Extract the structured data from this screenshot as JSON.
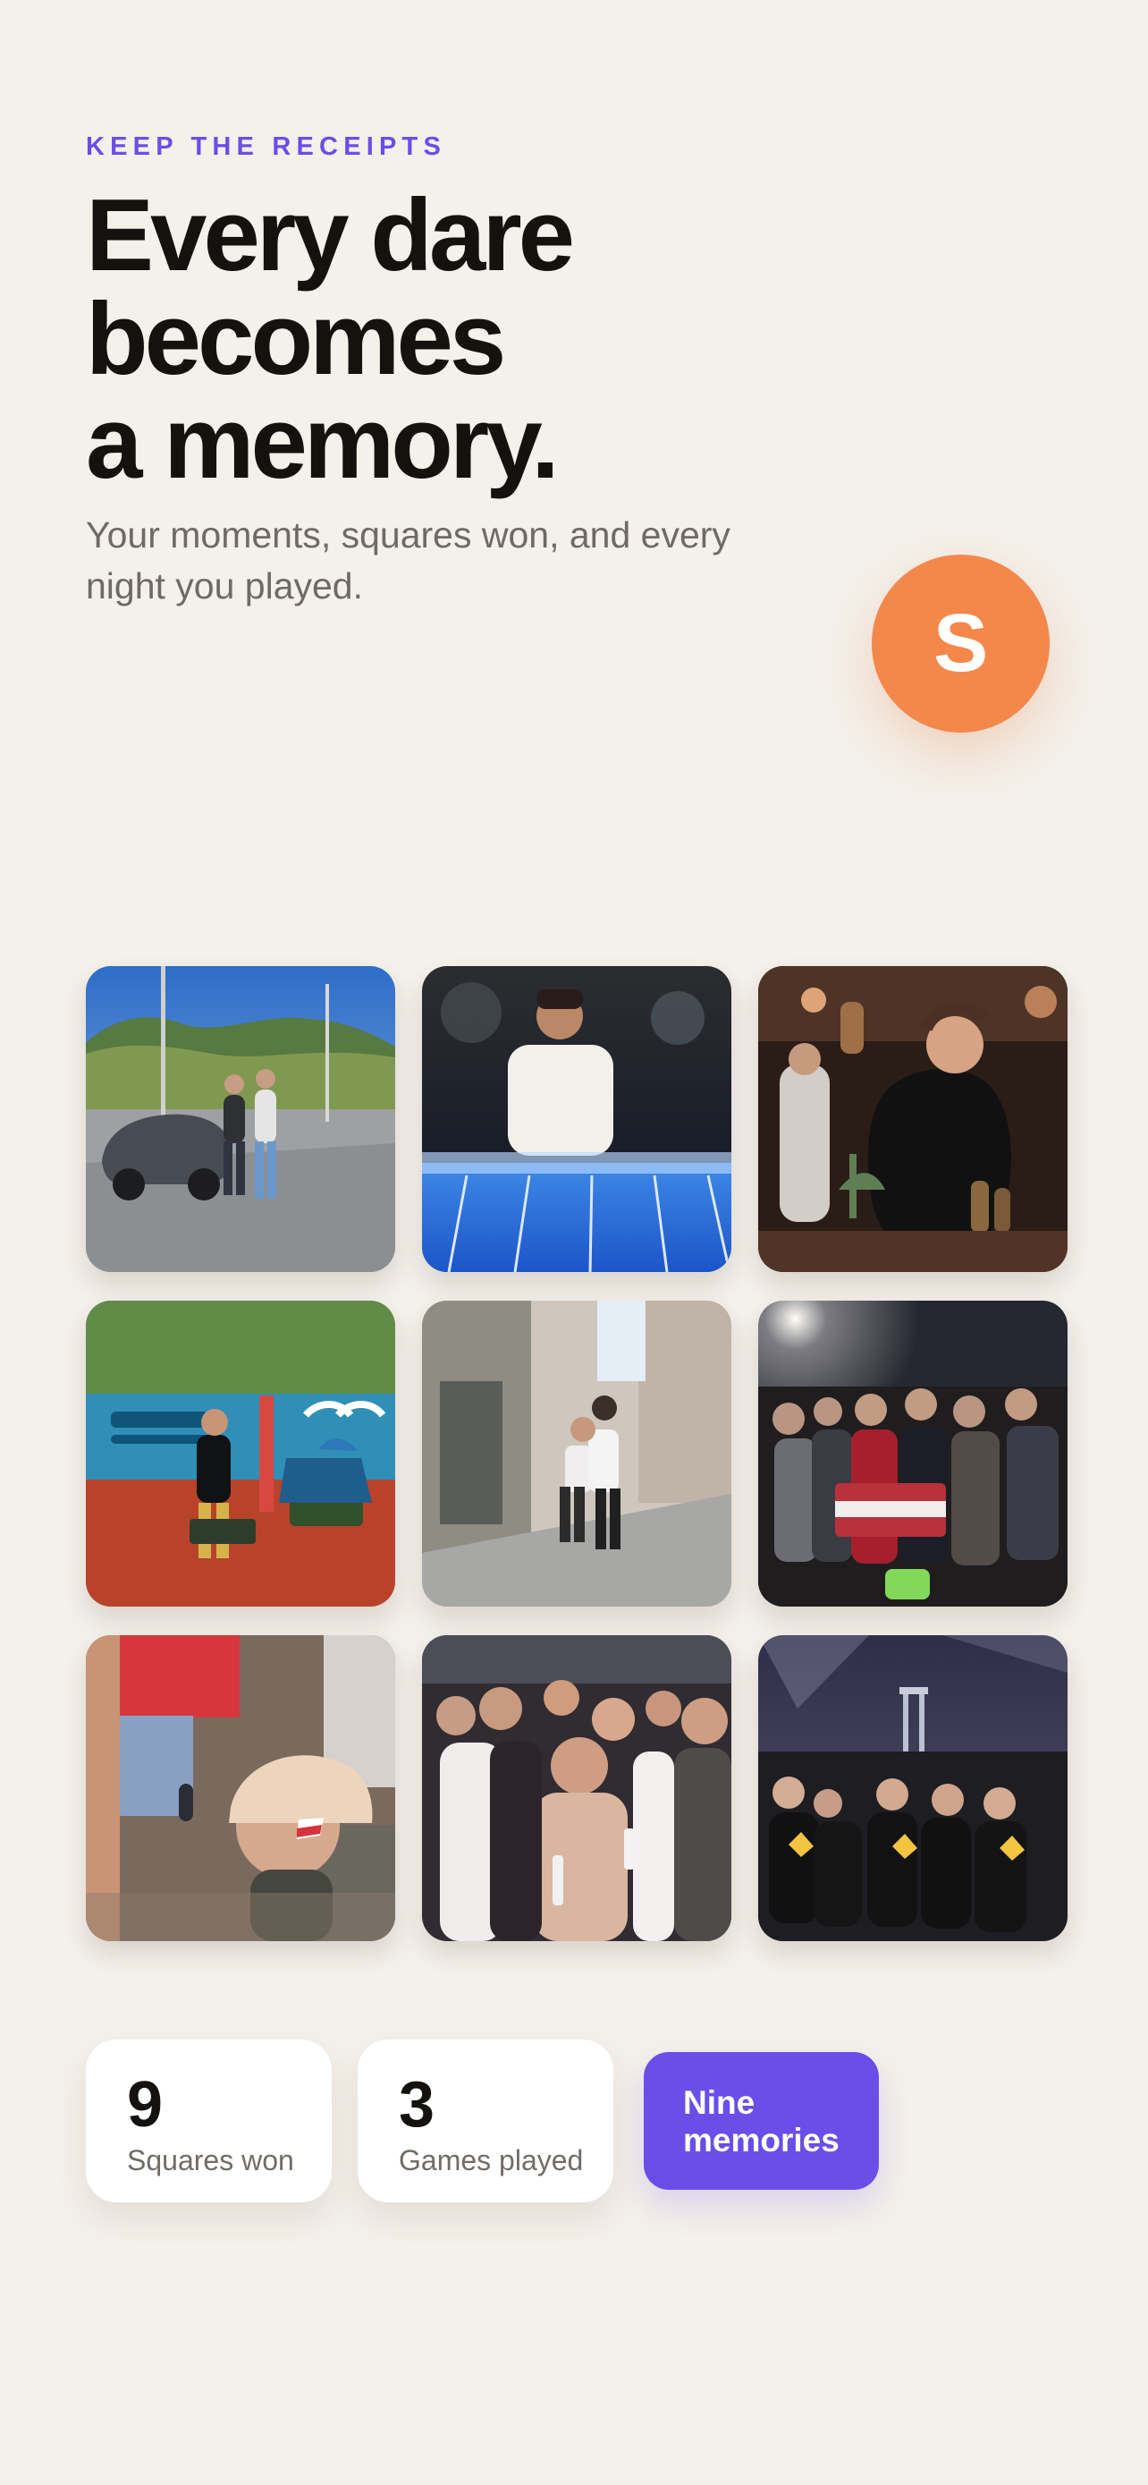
{
  "hero": {
    "eyebrow": "KEEP THE RECEIPTS",
    "headline_lines": [
      "Every dare",
      "becomes",
      "a memory."
    ],
    "subtitle": "Your moments, squares won, and every night you played."
  },
  "avatar": {
    "initial": "S",
    "color": "#f4884b"
  },
  "gallery": {
    "photo_count": 9
  },
  "stats": {
    "squares_won": {
      "value": "9",
      "label": "Squares won"
    },
    "games_played": {
      "value": "3",
      "label": "Games played"
    },
    "memories_badge": {
      "lines": [
        "Nine",
        "memories"
      ]
    }
  },
  "theme": {
    "background": "#f4f0ea",
    "accent": "#6a4ee8",
    "text": "#14120f"
  }
}
